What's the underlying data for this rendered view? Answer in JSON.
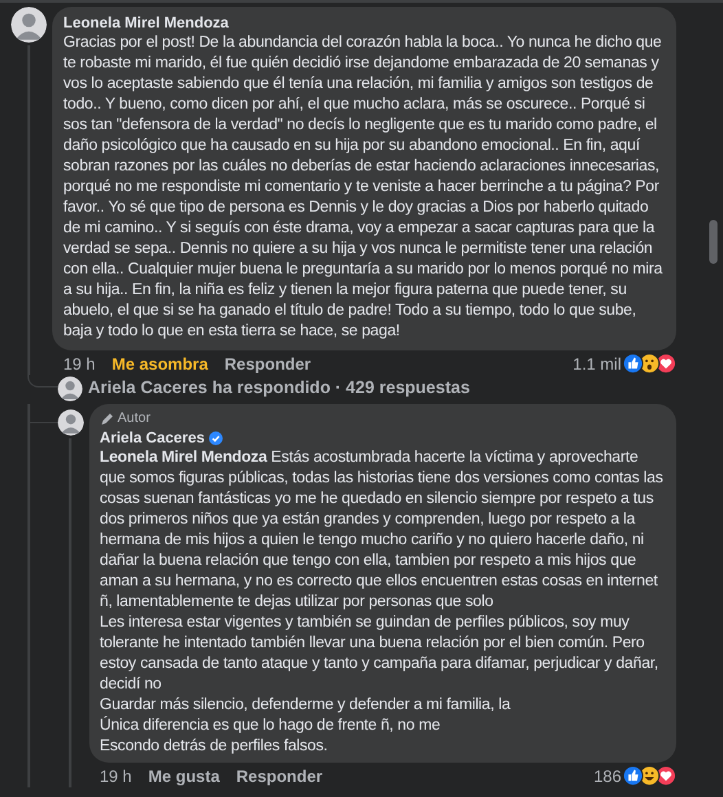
{
  "comment": {
    "author": "Leonela Mirel Mendoza",
    "text": "Gracias por el post! De la abundancia del corazón habla la boca.. Yo nunca he dicho que te robaste mi marido, él fue quién decidió irse dejandome embarazada de 20 semanas y vos lo aceptaste sabiendo que él tenía una relación, mi familia y amigos son testigos de todo.. Y bueno, como dicen por ahí, el que mucho aclara, más se oscurece.. Porqué si sos tan \"defensora de la verdad\" no decís lo negligente que es tu marido como padre, el daño psicológico que ha causado en su hija por su abandono emocional.. En fin, aquí sobran razones por las cuáles no deberías de estar haciendo aclaraciones innecesarias, porqué no me respondiste mi comentario y te veniste a hacer berrinche a tu página? Por favor.. Yo sé que tipo de persona es Dennis y le doy gracias a Dios por haberlo quitado de mi camino.. Y si seguís con éste drama, voy a empezar a sacar capturas para que la verdad se sepa.. Dennis no quiere a su hija y vos nunca le permitiste tener una relación con ella.. Cualquier mujer buena le preguntaría a su marido por lo menos porqué no mira a su hija.. En fin, la niña es feliz y tienen la mejor figura paterna que puede tener, su abuelo, el que si se ha ganado el título de padre! Todo a su tiempo, todo lo que sube, baja y todo lo que en esta tierra se hace, se paga!",
    "time": "19 h",
    "reaction": {
      "label": "Me asombra",
      "reacted": true,
      "kind": "wow"
    },
    "reply_label": "Responder",
    "count": "1.1 mil",
    "reactions": [
      {
        "kind": "like"
      },
      {
        "kind": "wow"
      },
      {
        "kind": "love"
      }
    ]
  },
  "replies_summary": "Ariela Caceres ha respondido · 429 respuestas",
  "reply": {
    "badge": "Autor",
    "author": "Ariela Caceres",
    "verified": true,
    "lines": [
      "**Leonela Mirel Mendoza** Estás acostumbrada hacerte la víctima y aprovecharte que somos figuras públicas, todas las historias tiene dos versiones como contas las cosas suenan fantásticas yo me he quedado en silencio siempre por respeto a tus dos primeros niños que ya están grandes y comprenden, luego por respeto a la hermana de mis hijos a quien le tengo mucho cariño y no quiero hacerle daño, ni dañar la buena relación que tengo con ella, tambien por respeto a mis hijos que aman a su hermana, y no es correcto que ellos encuentren estas cosas en internet ñ, lamentablemente te dejas utilizar por personas que solo",
      "Les interesa estar vigentes y también se guindan de perfiles públicos, soy muy tolerante he intentado también llevar una buena relación por el bien común. Pero estoy cansada de tanto ataque y tanto y campaña para difamar, perjudicar y dañar, decidí no",
      "Guardar más silencio, defenderme y defender a mi familia, la",
      "Única diferencia es que lo hago de frente ñ, no me",
      "Escondo detrás de perfiles falsos."
    ],
    "time": "19 h",
    "reaction": {
      "label": "Me gusta",
      "reacted": false
    },
    "reply_label": "Responder",
    "count": "186",
    "reactions": [
      {
        "kind": "like"
      },
      {
        "kind": "haha"
      },
      {
        "kind": "love"
      }
    ]
  }
}
